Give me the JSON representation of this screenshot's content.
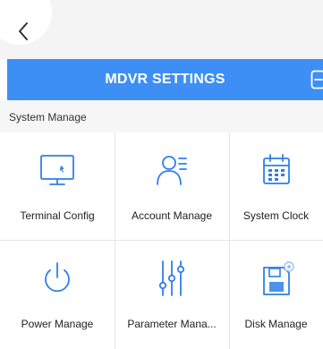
{
  "colors": {
    "header_blue": "#3d8ff5",
    "icon_blue": "#2f7fe8",
    "background": "#ffffff",
    "section_bg": "#f6f6f6",
    "divider": "#e6e6e6"
  },
  "header": {
    "title": "MDVR SETTINGS",
    "back_icon": "chevron-left-icon",
    "exit_icon": "exit-icon"
  },
  "section": {
    "title": "System Manage"
  },
  "items": [
    {
      "label": "Terminal Config",
      "icon": "monitor-icon"
    },
    {
      "label": "Account Manage",
      "icon": "user-list-icon"
    },
    {
      "label": "System Clock",
      "icon": "calendar-icon"
    },
    {
      "label": "Power Manage",
      "icon": "power-icon"
    },
    {
      "label": "Parameter Mana...",
      "icon": "sliders-icon"
    },
    {
      "label": "Disk Manage",
      "icon": "disk-icon"
    }
  ]
}
